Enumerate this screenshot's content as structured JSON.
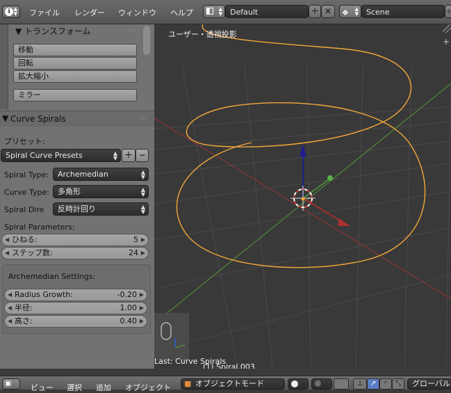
{
  "top_header": {
    "menus": [
      "ファイル",
      "レンダー",
      "ウィンドウ",
      "ヘルプ"
    ],
    "screen_layout": "Default",
    "scene": "Scene"
  },
  "tool_shelf": {
    "transform_title": "トランスフォーム",
    "transform_buttons": [
      "移動",
      "回転",
      "拡大縮小"
    ],
    "mirror_button": "ミラー",
    "panel_title": "Curve Spirals",
    "preset_label": "プリセット:",
    "preset_value": "Spiral Curve Presets",
    "spiral_type_label": "Spiral Type:",
    "spiral_type_value": "Archemedian",
    "curve_type_label": "Curve Type:",
    "curve_type_value": "多角形",
    "spiral_dir_label": "Spiral Dire",
    "spiral_dir_value": "反時計回り",
    "params_label": "Spiral Parameters:",
    "params": [
      {
        "label": "ひねる:",
        "value": "5"
      },
      {
        "label": "ステップ数:",
        "value": "24"
      }
    ],
    "settings_label": "Archemedian Settings:",
    "settings": [
      {
        "label": "Radius Growth:",
        "value": "-0.20"
      },
      {
        "label": "半径:",
        "value": "1.00"
      },
      {
        "label": "高さ:",
        "value": "0.40"
      }
    ]
  },
  "viewport": {
    "title": "ユーザー・透視投影",
    "last_operator": "Last: Curve Spirals",
    "object_name": "(1) Spiral.003"
  },
  "bottom_header": {
    "menus": [
      "ビュー",
      "選択",
      "追加",
      "オブジェクト"
    ],
    "mode": "オブジェクトモード",
    "orientation": "グローバル"
  },
  "colors": {
    "curve": "#f4a83a",
    "x_axis": "#a33a3a",
    "y_axis": "#6aa84f",
    "z_arrow": "#1f1f8f"
  }
}
